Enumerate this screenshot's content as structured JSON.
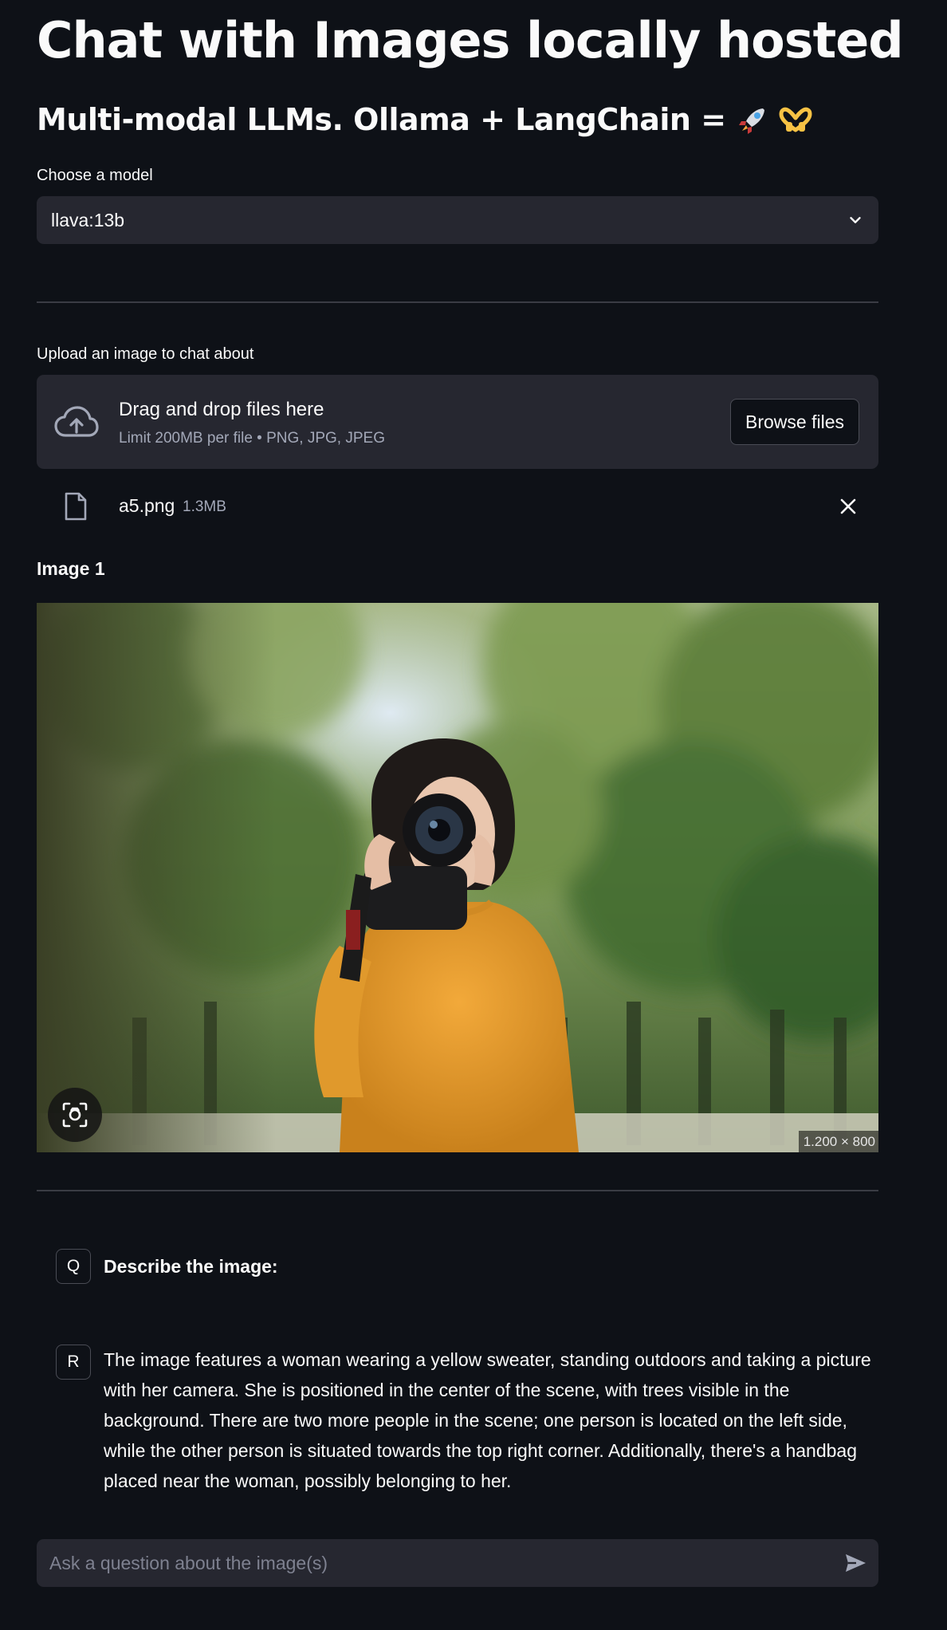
{
  "header": {
    "title": "Chat with Images locally hosted",
    "subtitle": "Multi-modal LLMs. Ollama + LangChain = "
  },
  "model_select": {
    "label": "Choose a model",
    "value": "llava:13b"
  },
  "uploader": {
    "label": "Upload an image to chat about",
    "drop_title": "Drag and drop files here",
    "drop_subtitle": "Limit 200MB per file • PNG, JPG, JPEG",
    "browse_label": "Browse files",
    "file": {
      "name": "a5.png",
      "size": "1.3MB"
    }
  },
  "image": {
    "caption": "Image 1",
    "dimensions": "1.200 × 800"
  },
  "messages": [
    {
      "avatar": "Q",
      "text": "Describe the image:",
      "bold": true
    },
    {
      "avatar": "R",
      "text": "The image features a woman wearing a yellow sweater, standing outdoors and taking a picture with her camera. She is positioned in the center of the scene, with trees visible in the background. There are two more people in the scene; one person is located on the left side, while the other person is situated towards the top right corner. Additionally, there's a handbag placed near the woman, possibly belonging to her.",
      "bold": false
    }
  ],
  "chat_input": {
    "placeholder": "Ask a question about the image(s)"
  },
  "icons": {
    "select": "chevron-down-icon",
    "upload": "cloud-upload-icon",
    "file": "file-icon",
    "remove": "close-icon",
    "screenshot": "camera-search-icon",
    "send": "send-icon",
    "subtitle_emoji": [
      "rocket-emoji",
      "heart-hands-emoji"
    ]
  },
  "colors": {
    "background": "#0e1117",
    "surface": "#262730",
    "text": "#fafafa",
    "muted": "#a3a8b8",
    "divider": "#3a3c44"
  }
}
